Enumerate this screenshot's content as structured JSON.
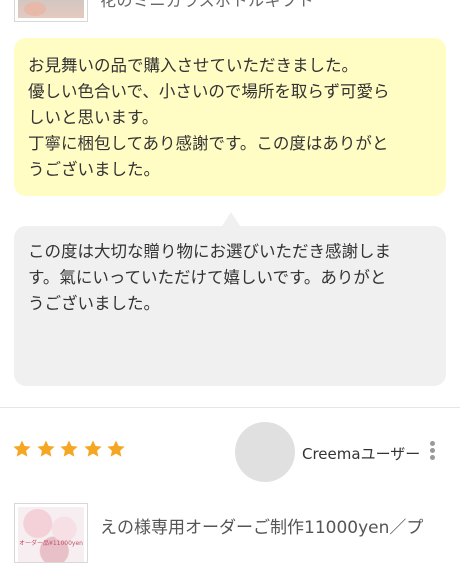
{
  "top_product": {
    "title": "花のミニガラスボトルギフト"
  },
  "review": {
    "lines": [
      "お見舞いの品で購入させていただきました。",
      "優しい色合いで、小さいので場所を取らず可愛ら",
      "しいと思います。",
      "丁寧に梱包してあり感謝です。この度はありがと",
      "うございました。"
    ]
  },
  "reply": {
    "lines": [
      "この度は大切な贈り物にお選びいただき感謝しま",
      "す。氣にいっていただけて嬉しいです。ありがと",
      "うございました。"
    ]
  },
  "next_review": {
    "rating": 5,
    "star_color": "#f5a623",
    "username": "Creemaユーザー",
    "product_thumb_text": "オーダー品¥11000yen",
    "product_title_line": "えの様専用オーダーご制作11000yen／プ"
  }
}
